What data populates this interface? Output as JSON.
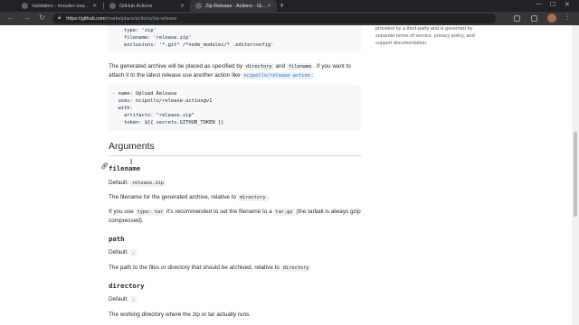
{
  "browser": {
    "tabs": [
      {
        "label": "Validation - musdev-examples/..."
      },
      {
        "label": "GitHub Actions"
      },
      {
        "label": "Zip Release - Actions - GitHub M..."
      }
    ],
    "new_tab": "+",
    "url_host": "https://github.com",
    "url_path": "/marketplace/actions/zip-release"
  },
  "page": {
    "top_code": "    type: 'zip'\n    filename: 'release.zip'\n    exclusions: '*.git* /*node_modules/* .editorconfig'",
    "generated_1": "The generated archive will be placed as specified by ",
    "generated_code1": "directory",
    "generated_and": " and ",
    "generated_code2": "filename",
    "generated_2": ". If you want to attach it to the latest release use another action like ",
    "generated_link": "ncipollo/release-action",
    "generated_3": ":",
    "upload_code": "- name: Upload Release\n  uses: ncipollo/release-action@v1\n  with:\n    artifacts: \"release.zip\"\n    token: ${{ secrets.GITHUB_TOKEN }}",
    "arguments_heading": "Arguments",
    "args": {
      "filename": {
        "name": "filename",
        "default_label": "Default: ",
        "default_value": "release.zip",
        "desc1_a": "The filename for the generated archive, relative to ",
        "desc1_code": "directory",
        "desc1_b": ".",
        "desc2_a": "If you use ",
        "desc2_code1": "type: tar",
        "desc2_b": " it's recommended to set the filename to a ",
        "desc2_code2": "tar.gz",
        "desc2_c": " (the tarball is always gzip compressed)."
      },
      "path": {
        "name": "path",
        "default_label": "Default: ",
        "default_value": ".",
        "desc_a": "The path to the files or directory that should be archived, relative to ",
        "desc_code": "directory"
      },
      "directory": {
        "name": "directory",
        "default_label": "Default: ",
        "default_value": ".",
        "desc": "The working directory where the zip or tar actually runs."
      }
    },
    "sidebar_note": "provided by a third-party and is governed by separate terms of service, privacy policy, and support documentation."
  }
}
